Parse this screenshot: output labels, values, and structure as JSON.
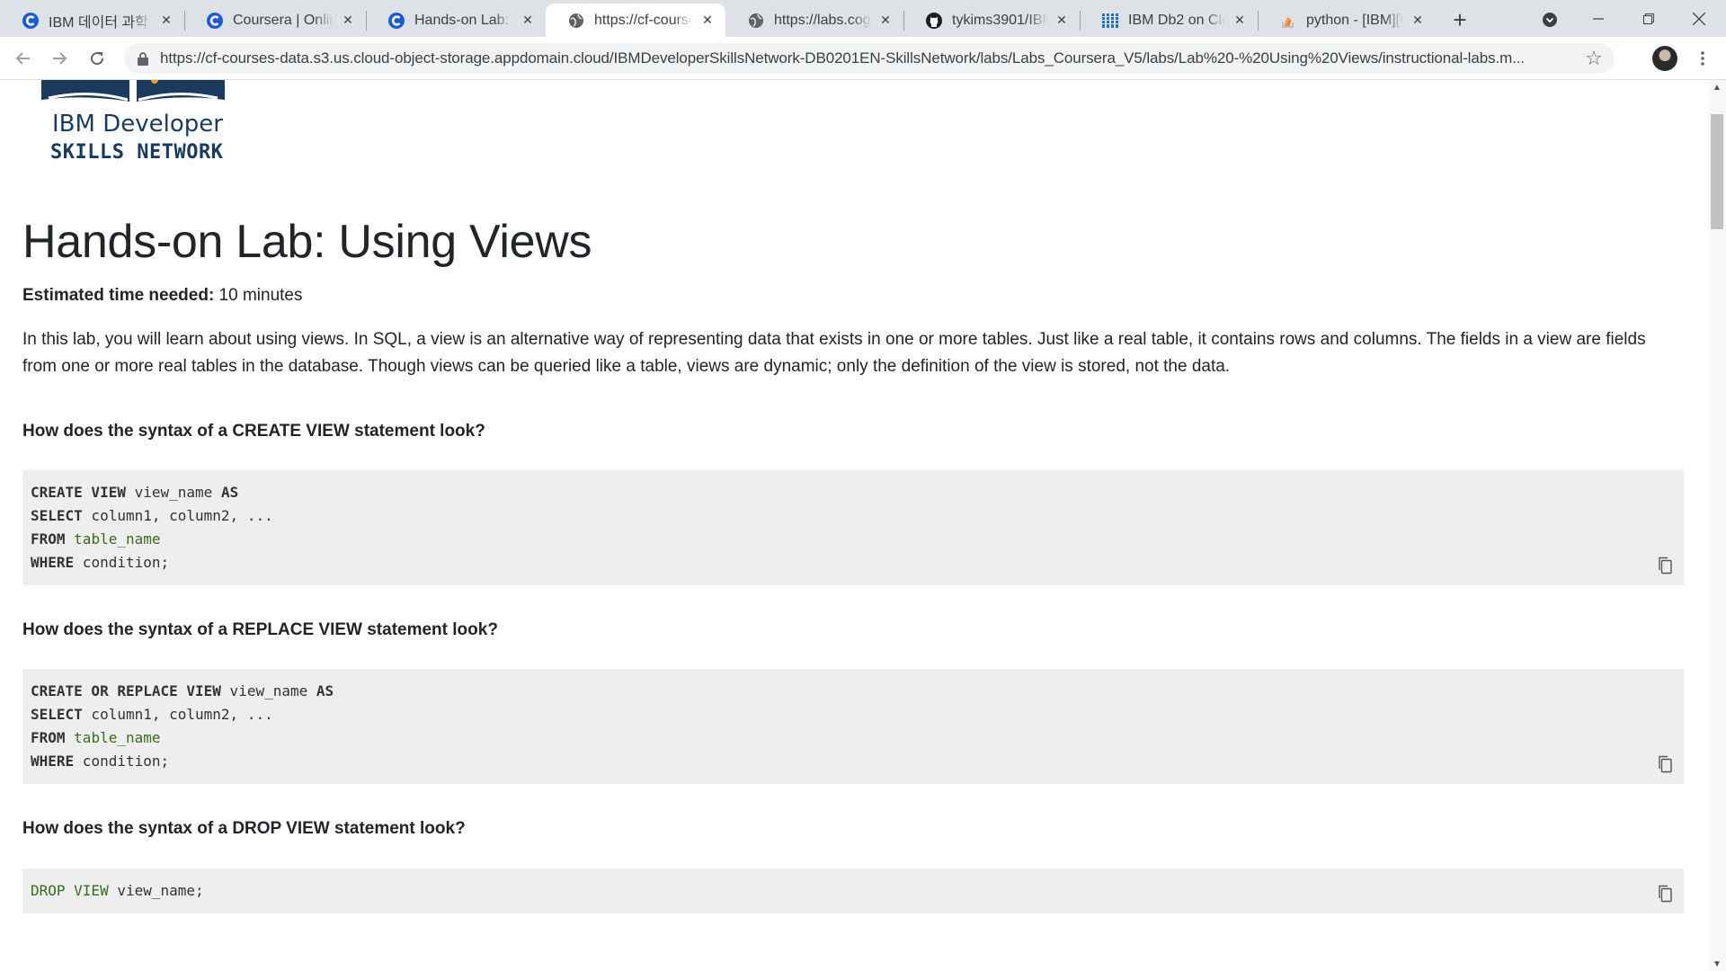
{
  "browser": {
    "tabs": [
      {
        "title": "IBM 데이터 과학",
        "icon": "coursera-icon"
      },
      {
        "title": "Coursera | Online",
        "icon": "coursera-icon"
      },
      {
        "title": "Hands-on Lab: Us",
        "icon": "coursera-icon"
      },
      {
        "title": "https://cf-courses",
        "icon": "globe-icon",
        "active": true
      },
      {
        "title": "https://labs.cogni",
        "icon": "globe-icon"
      },
      {
        "title": "tykims3901/IBM-",
        "icon": "github-icon"
      },
      {
        "title": "IBM Db2 on Clou",
        "icon": "ibm-icon"
      },
      {
        "title": "python - [IBM][C",
        "icon": "stackoverflow-icon"
      }
    ],
    "url": "https://cf-courses-data.s3.us.cloud-object-storage.appdomain.cloud/IBMDeveloperSkillsNetwork-DB0201EN-SkillsNetwork/labs/Labs_Coursera_V5/labs/Lab%20-%20Using%20Views/instructional-labs.m..."
  },
  "logo": {
    "line1": "IBM Developer",
    "line2": "SKILLS NETWORK"
  },
  "page": {
    "title": "Hands-on Lab: Using Views",
    "est_label": "Estimated time needed:",
    "est_value": " 10 minutes",
    "intro": "In this lab, you will learn about using views. In SQL, a view is an alternative way of representing data that exists in one or more tables. Just like a real table, it contains rows and columns. The fields in a view are fields from one or more real tables in the database. Though views can be queried like a table, views are dynamic; only the definition of the view is stored, not the data."
  },
  "sections": [
    {
      "heading": "How does the syntax of a CREATE VIEW statement look?",
      "code": [
        [
          {
            "t": "CREATE VIEW",
            "c": "kw"
          },
          {
            "t": " view_name ",
            "c": ""
          },
          {
            "t": "AS",
            "c": "kw"
          }
        ],
        [
          {
            "t": "SELECT",
            "c": "kw"
          },
          {
            "t": " column1, column2, ...",
            "c": ""
          }
        ],
        [
          {
            "t": "FROM",
            "c": "kw"
          },
          {
            "t": " ",
            "c": ""
          },
          {
            "t": "table_name",
            "c": "id"
          }
        ],
        [
          {
            "t": "WHERE",
            "c": "kw"
          },
          {
            "t": " condition;",
            "c": ""
          }
        ]
      ]
    },
    {
      "heading": "How does the syntax of a REPLACE VIEW statement look?",
      "code": [
        [
          {
            "t": "CREATE OR REPLACE VIEW",
            "c": "kw"
          },
          {
            "t": " view_name ",
            "c": ""
          },
          {
            "t": "AS",
            "c": "kw"
          }
        ],
        [
          {
            "t": "SELECT",
            "c": "kw"
          },
          {
            "t": " column1, column2, ...",
            "c": ""
          }
        ],
        [
          {
            "t": "FROM",
            "c": "kw"
          },
          {
            "t": " ",
            "c": ""
          },
          {
            "t": "table_name",
            "c": "id"
          }
        ],
        [
          {
            "t": "WHERE",
            "c": "kw"
          },
          {
            "t": " condition;",
            "c": ""
          }
        ]
      ]
    },
    {
      "heading": "How does the syntax of a DROP VIEW statement look?",
      "code": [
        [
          {
            "t": "DROP VIEW",
            "c": "kw-green"
          },
          {
            "t": " view_name;",
            "c": ""
          }
        ]
      ]
    }
  ]
}
